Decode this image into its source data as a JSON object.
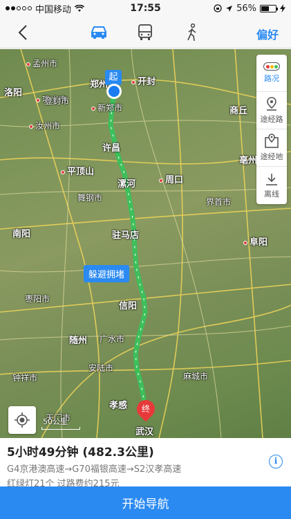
{
  "status_bar": {
    "carrier": "中国移动",
    "time": "17:55",
    "battery_percent": "56%",
    "battery_level": 0.56
  },
  "nav": {
    "preference_label": "偏好",
    "modes": [
      {
        "name": "car",
        "icon": "car-icon",
        "active": true
      },
      {
        "name": "bus",
        "icon": "bus-icon",
        "active": false
      },
      {
        "name": "walk",
        "icon": "walk-icon",
        "active": false
      }
    ],
    "accent_color": "#2a8af2"
  },
  "map": {
    "start_label": "起",
    "end_label": "终",
    "avoid_congestion_label": "躲避拥堵",
    "scale_label": "50公里",
    "route_color": "#3dbf5a",
    "cities": [
      {
        "id": "mengzhou",
        "name": "孟州市"
      },
      {
        "id": "gongyi",
        "name": "巩义市"
      },
      {
        "id": "luoyang",
        "name": "洛阳"
      },
      {
        "id": "zhengzhou",
        "name": "郑州"
      },
      {
        "id": "kaifeng",
        "name": "开封"
      },
      {
        "id": "dengfeng",
        "name": "登封市"
      },
      {
        "id": "xinzheng",
        "name": "新郑市"
      },
      {
        "id": "shangqiu",
        "name": "商丘"
      },
      {
        "id": "ruzhou",
        "name": "汝州市"
      },
      {
        "id": "xuchang",
        "name": "许昌"
      },
      {
        "id": "bozhou",
        "name": "亳州"
      },
      {
        "id": "pingdingshan",
        "name": "平顶山"
      },
      {
        "id": "luohe",
        "name": "漯河"
      },
      {
        "id": "zhoukou",
        "name": "周口"
      },
      {
        "id": "wugang",
        "name": "舞钢市"
      },
      {
        "id": "jieshou",
        "name": "界首市"
      },
      {
        "id": "nanyang",
        "name": "南阳"
      },
      {
        "id": "zhumadian",
        "name": "驻马店"
      },
      {
        "id": "fuyang",
        "name": "阜阳"
      },
      {
        "id": "zaoyang",
        "name": "枣阳市"
      },
      {
        "id": "xinyang",
        "name": "信阳"
      },
      {
        "id": "suizhou",
        "name": "随州"
      },
      {
        "id": "guangshui",
        "name": "广水市"
      },
      {
        "id": "anlu",
        "name": "安陆市"
      },
      {
        "id": "zhongxiang",
        "name": "钟祥市"
      },
      {
        "id": "macheng",
        "name": "麻城市"
      },
      {
        "id": "xiaogan",
        "name": "孝感"
      },
      {
        "id": "tianmen",
        "name": "天门市"
      },
      {
        "id": "wuhan",
        "name": "武汉"
      }
    ],
    "tools": [
      {
        "id": "traffic",
        "label": "路况",
        "active": true
      },
      {
        "id": "waypoint",
        "label": "途经路",
        "active": false
      },
      {
        "id": "via",
        "label": "途经地",
        "active": false
      },
      {
        "id": "offline",
        "label": "离线",
        "active": false
      }
    ]
  },
  "route": {
    "duration_distance": "5小时49分钟 (482.3公里)",
    "roads": "G4京港澳高速→G70福银高速→S2汉孝高速",
    "cost": "红绿灯21个 过路费约215元"
  },
  "start_nav_label": "开始导航"
}
